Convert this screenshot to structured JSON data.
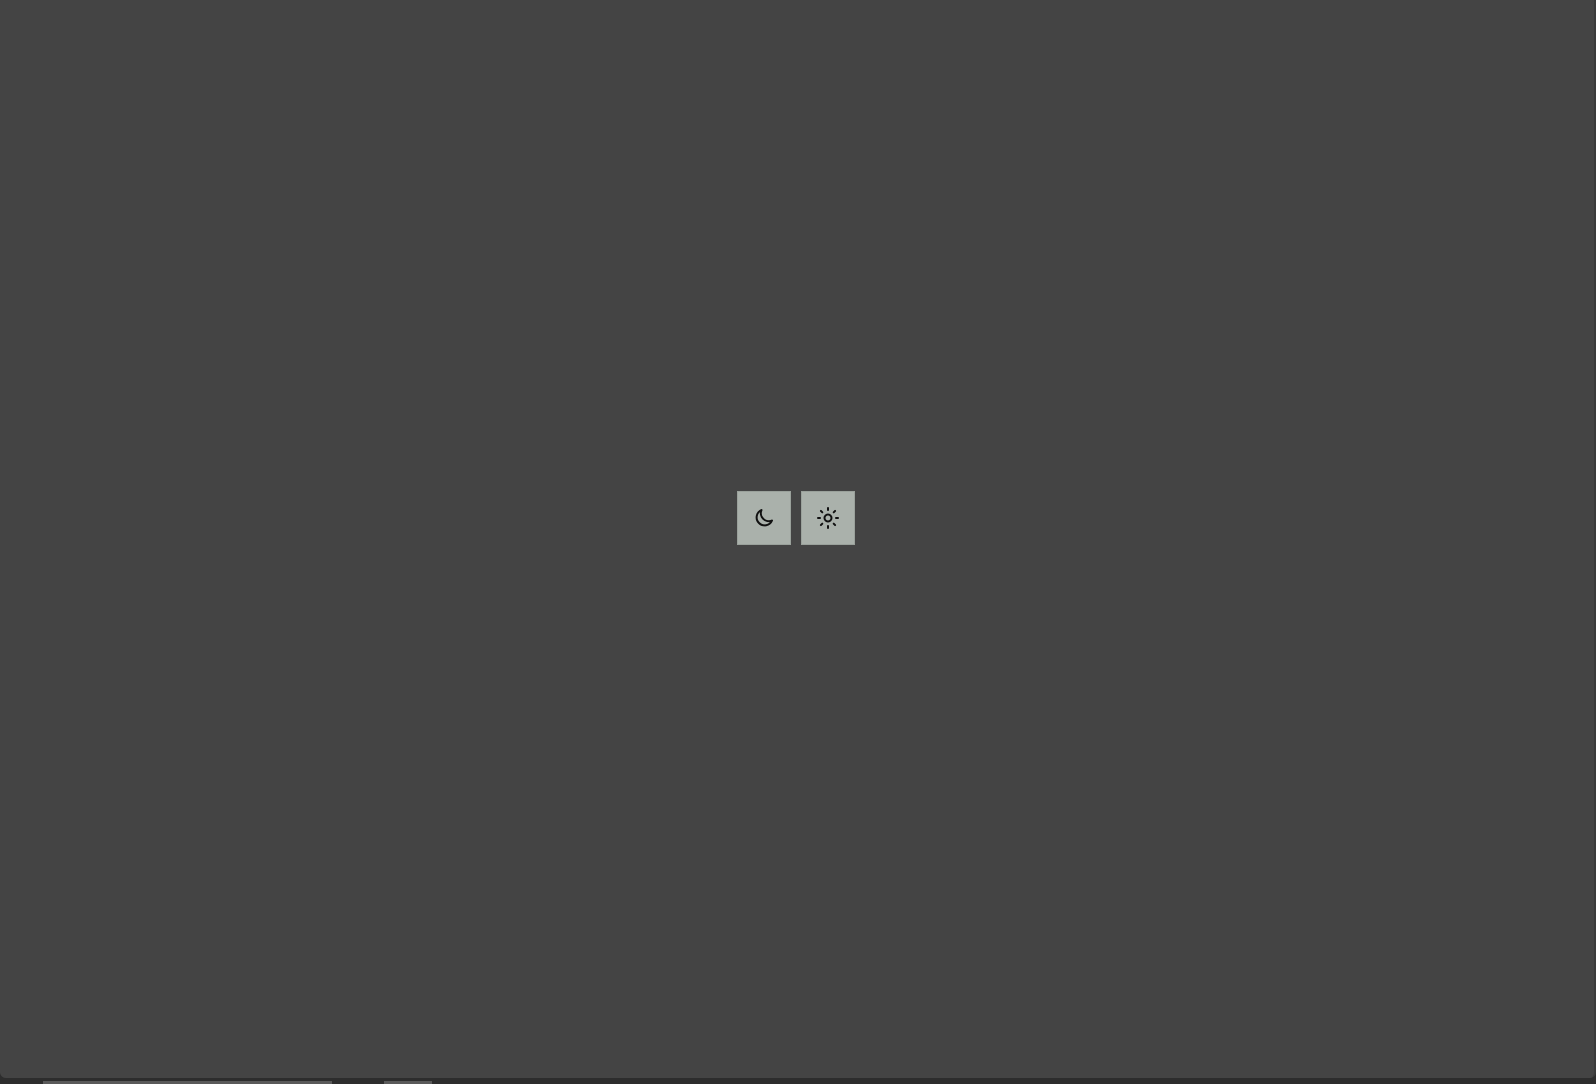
{
  "theme_toggle": {
    "buttons": [
      {
        "name": "dark-mode-button",
        "icon": "moon-icon",
        "accent": "#aab1ab"
      },
      {
        "name": "light-mode-button",
        "icon": "sun-icon",
        "accent": "#aab1ab"
      }
    ]
  },
  "colors": {
    "background": "#444444",
    "button_background": "#aab1ab",
    "icon": "#111111"
  }
}
